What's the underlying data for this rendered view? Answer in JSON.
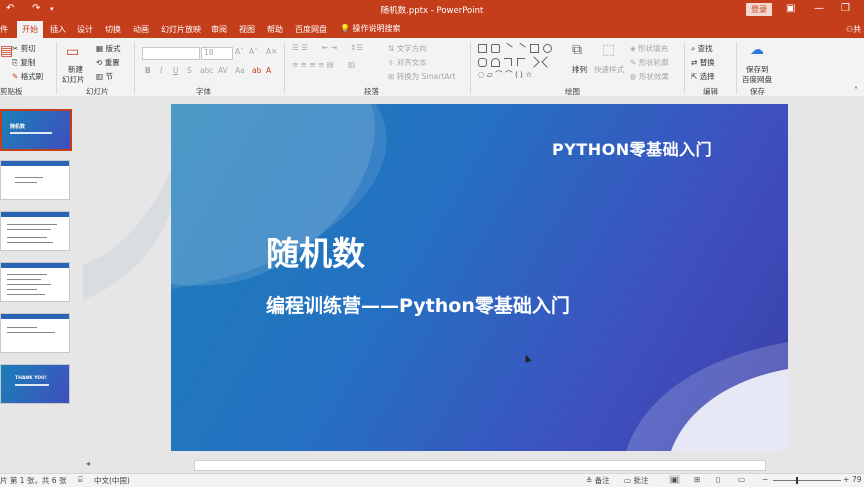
{
  "titlebar": {
    "doc_title": "随机数.pptx  -  PowerPoint",
    "login": "登录",
    "undo": "↶",
    "redo": "↷",
    "minimize": "—",
    "restore": "❐"
  },
  "tabs": {
    "file": "件",
    "items": [
      "开始",
      "插入",
      "设计",
      "切换",
      "动画",
      "幻灯片放映",
      "审阅",
      "视图",
      "帮助",
      "百度网盘"
    ],
    "tellme": "操作说明搜索",
    "share": "共"
  },
  "ribbon": {
    "clipboard": {
      "cut": "剪切",
      "copy": "复制",
      "painter": "格式刷",
      "group": "剪贴板"
    },
    "slides": {
      "new_slide": "新建",
      "new_slide2": "幻灯片",
      "layout": "版式",
      "reset": "重置",
      "section": "节",
      "group": "幻灯片"
    },
    "font": {
      "size": "18",
      "bold": "B",
      "italic": "I",
      "underline": "U",
      "strike": "S",
      "group": "字体"
    },
    "paragraph": {
      "text_direction": "文字方向",
      "align_text": "对齐文本",
      "smartart": "转换为 SmartArt",
      "group": "段落"
    },
    "drawing": {
      "arrange": "排列",
      "quick_styles": "快速样式",
      "fill": "形状填充",
      "outline": "形状轮廓",
      "effects": "形状效果",
      "group": "绘图"
    },
    "editing": {
      "find": "查找",
      "replace": "替换",
      "select": "选择",
      "group": "编辑"
    },
    "save": {
      "label1": "保存到",
      "label2": "百度网盘",
      "group": "保存"
    }
  },
  "thumbnails": {
    "numbers": [
      "1",
      "2",
      "3",
      "4",
      "5",
      "6"
    ],
    "thumb1_title": "随机数",
    "thumb6_title": "THANK YOU!"
  },
  "slide": {
    "header": "PYTHON零基础入门",
    "title": "随机数",
    "subtitle": "编程训练营——Python零基础入门"
  },
  "status": {
    "slide_info": "片 第 1 张，共 6 张",
    "language": "中文(中国)",
    "notes": "备注",
    "comments": "批注",
    "zoom": "79"
  },
  "colors": {
    "accent": "#c43e1c",
    "slide_blue": "#2570c2",
    "slide_purple": "#3f4fbe"
  }
}
